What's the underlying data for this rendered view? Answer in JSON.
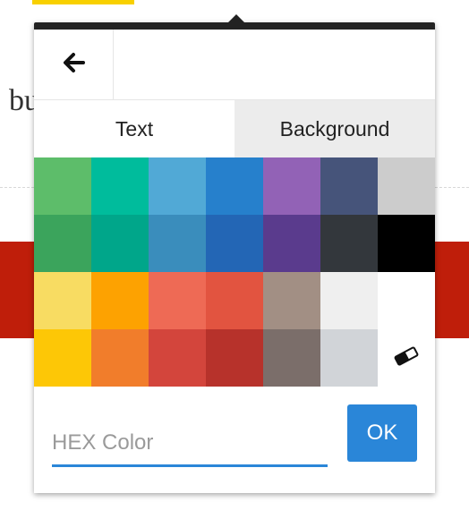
{
  "toolbar": {
    "back_icon": "arrow-left-icon"
  },
  "tabs": [
    {
      "label": "Text",
      "active": true
    },
    {
      "label": "Background",
      "active": false
    }
  ],
  "swatches": [
    [
      "#5dbd6a",
      "#00bc9c",
      "#51a9d6",
      "#2680cc",
      "#9262b6",
      "#46547a",
      "#cccccc"
    ],
    [
      "#3ba45c",
      "#00a68a",
      "#3a8dbc",
      "#2366b5",
      "#5a3b8d",
      "#33373c",
      "#000000"
    ],
    [
      "#f8dc62",
      "#fda201",
      "#ee6a55",
      "#e25440",
      "#a28f84",
      "#efefef",
      "#ffffff"
    ],
    [
      "#fdc706",
      "#f17d2b",
      "#d3453c",
      "#b7322b",
      "#7b6e6a",
      "#d1d4d8",
      null
    ]
  ],
  "eraser_icon": "eraser-icon",
  "hex_input": {
    "placeholder": "HEX Color",
    "value": ""
  },
  "ok_button": {
    "label": "OK"
  },
  "colors": {
    "accent": "#2a86d8",
    "page_red": "#bf1e0a",
    "highlight": "#f8d000"
  }
}
